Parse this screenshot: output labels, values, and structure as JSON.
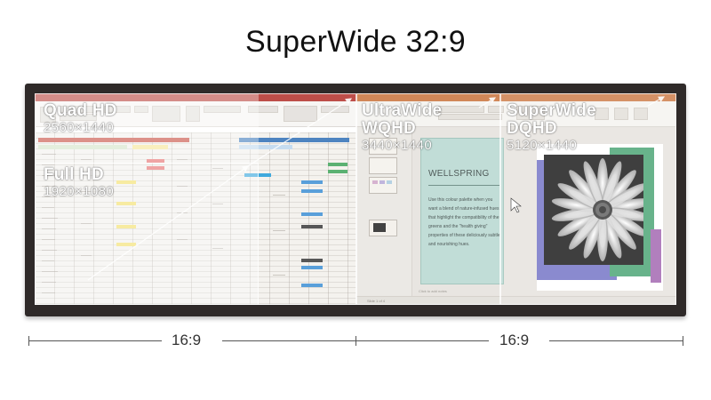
{
  "title": "SuperWide 32:9",
  "resolutions": {
    "quad_hd": {
      "name": "Quad HD",
      "dims": "2560×1440"
    },
    "full_hd": {
      "name": "Full HD",
      "dims": "1920×1080"
    },
    "ultrawide": {
      "name": "UltraWide",
      "name2": "WQHD",
      "dims": "3440×1440"
    },
    "superwide": {
      "name": "SuperWide",
      "name2": "DQHD",
      "dims": "5120×1440"
    }
  },
  "slide": {
    "heading": "WELLSPRING",
    "body": "Use this colour palette when you want a blend of nature-infused hues that highlight the compatibility of the greens and the \"health giving\" properties of these deliciously subtle and nourishing hues.",
    "counter": "Slide 1 of 4",
    "notes_placeholder": "Click to add notes"
  },
  "aspect": {
    "left": "16:9",
    "right": "16:9"
  },
  "colors": {
    "excel_accent": "#b3302a",
    "ppt_accent": "#c9733b",
    "slide_teal": "#b7d7d0",
    "frame_purple": "#6a6ac2",
    "frame_green": "#3e9e6b"
  }
}
